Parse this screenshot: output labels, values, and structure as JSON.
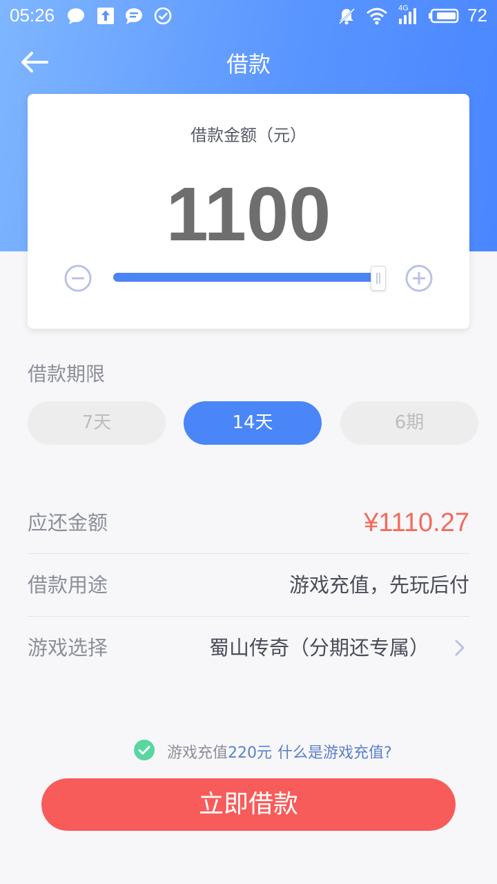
{
  "status_bar": {
    "time": "05:26",
    "battery": "72",
    "network": "4G",
    "icons": [
      "chat-bubble-icon",
      "upload-icon",
      "message-icon",
      "check-circle-icon",
      "mute-bell-icon",
      "wifi-icon",
      "signal-icon",
      "battery-icon"
    ]
  },
  "nav": {
    "title": "借款",
    "back_icon": "arrow-left-icon"
  },
  "amount_card": {
    "label": "借款金额（元）",
    "value": "1100",
    "slider_fraction": 1.0
  },
  "term": {
    "title": "借款期限",
    "options": [
      {
        "label": "7天",
        "selected": false
      },
      {
        "label": "14天",
        "selected": true
      },
      {
        "label": "6期",
        "selected": false
      }
    ]
  },
  "rows": {
    "repay": {
      "label": "应还金额",
      "value": "¥1110.27"
    },
    "purpose": {
      "label": "借款用途",
      "value": "游戏充值，先玩后付"
    },
    "game": {
      "label": "游戏选择",
      "value": "蜀山传奇（分期还专属）"
    }
  },
  "agreement": {
    "prefix": "游戏充值",
    "amount": "220元",
    "link": "什么是游戏充值?"
  },
  "submit": {
    "label": "立即借款"
  },
  "colors": {
    "header_gradient_start": "#7fb6ff",
    "header_gradient_end": "#4a86ff",
    "accent_blue": "#4a86f7",
    "amount_red": "#f46a5c",
    "submit_red": "#f75c5a",
    "check_green": "#5ad6a0"
  }
}
